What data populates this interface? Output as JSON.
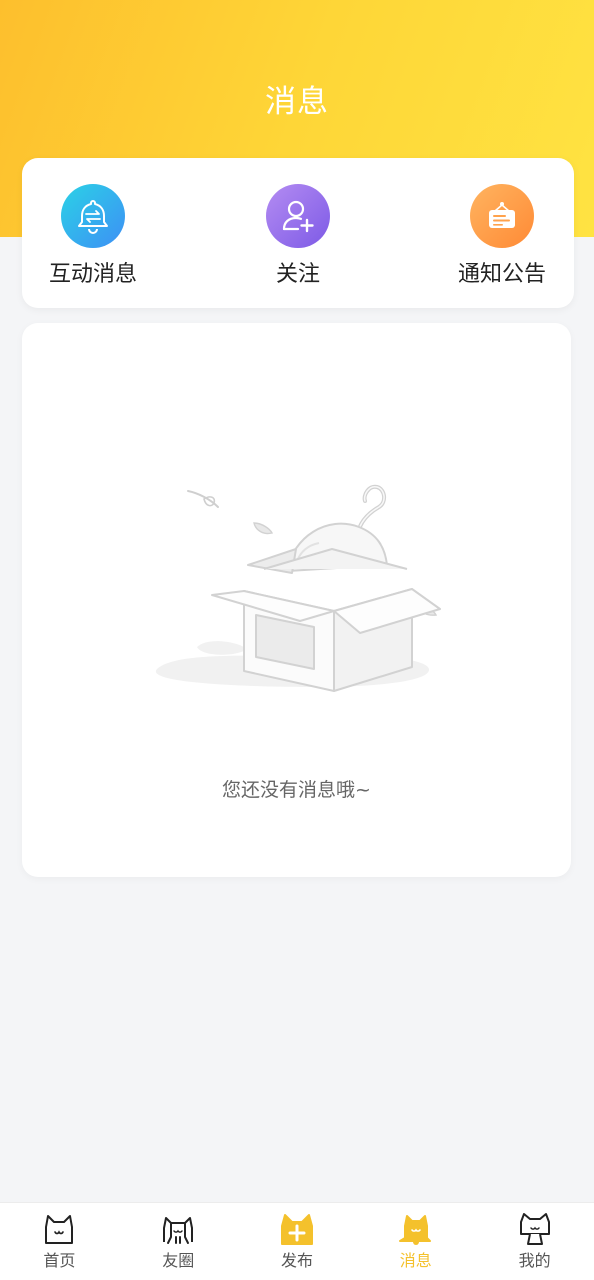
{
  "header": {
    "title": "消息"
  },
  "quick_actions": [
    {
      "label": "互动消息",
      "icon": "bell-exchange-icon",
      "color_from": "#2bd2e6",
      "color_to": "#3d8ff5"
    },
    {
      "label": "关注",
      "icon": "add-user-icon",
      "color_from": "#b48cf2",
      "color_to": "#7d5ae6"
    },
    {
      "label": "通知公告",
      "icon": "notice-board-icon",
      "color_from": "#ffb460",
      "color_to": "#ff8a35"
    }
  ],
  "empty_state": {
    "illustration": "empty-box-cat-icon",
    "text": "您还没有消息哦~"
  },
  "tabbar": {
    "active_color": "#f4c12c",
    "items": [
      {
        "label": "首页",
        "icon": "cat-home-icon",
        "active": false
      },
      {
        "label": "友圈",
        "icon": "cat-friends-icon",
        "active": false
      },
      {
        "label": "发布",
        "icon": "cat-publish-icon",
        "active": false
      },
      {
        "label": "消息",
        "icon": "cat-bell-icon",
        "active": true
      },
      {
        "label": "我的",
        "icon": "cat-profile-icon",
        "active": false
      }
    ]
  }
}
